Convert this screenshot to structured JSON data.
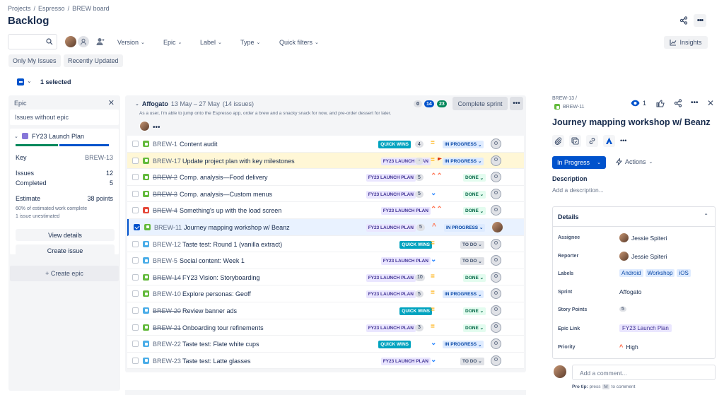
{
  "breadcrumbs": {
    "projects": "Projects",
    "project": "Espresso",
    "board": "BREW board"
  },
  "page_title": "Backlog",
  "toolbar": {
    "filters": [
      "Version",
      "Epic",
      "Label",
      "Type",
      "Quick filters"
    ],
    "insights": "Insights",
    "only_my_issues": "Only My Issues",
    "recently_updated": "Recently Updated"
  },
  "selection": {
    "text": "1 selected"
  },
  "epic_panel": {
    "header": "Epic",
    "issues_without_epic": "Issues without epic",
    "epic_name": "FY23 Launch Plan",
    "key_label": "Key",
    "key_value": "BREW-13",
    "issues_label": "Issues",
    "issues_value": "12",
    "completed_label": "Completed",
    "completed_value": "5",
    "estimate_label": "Estimate",
    "estimate_value": "38 points",
    "estimate_note": "60% of estimated work complete",
    "unestimated_note": "1 issue unestimated",
    "view_details": "View details",
    "create_issue": "Create issue",
    "create_epic": "+ Create epic"
  },
  "sprint": {
    "name": "Affogato",
    "dates": "13 May – 27 May",
    "count": "(14 issues)",
    "description": "As a user, I'm able to jump onto the Espresso app, order a brew and a snacky snack for now, and pre-order dessert for later.",
    "todo_count": "0",
    "inprogress_count": "14",
    "done_count": "23",
    "complete_label": "Complete sprint",
    "issues": [
      {
        "key": "BREW-1",
        "summary": "Content audit",
        "type": "story",
        "done": false,
        "label": "QUICK WINS",
        "label_type": "qw",
        "points": "4",
        "priority": "medium",
        "status": "IN PROGRESS",
        "status_type": "ip",
        "checked": false,
        "flag": false,
        "row": "",
        "photo": false
      },
      {
        "key": "BREW-17",
        "summary": "Update project plan with key milestones",
        "type": "story",
        "done": false,
        "label": "FY23 LAUNCH PLAN",
        "label_type": "fy",
        "points": "-",
        "priority": "medium",
        "status": "IN PROGRESS",
        "status_type": "ip",
        "checked": false,
        "flag": true,
        "row": "flag",
        "photo": false
      },
      {
        "key": "BREW-2",
        "summary": "Comp. analysis—Food delivery",
        "type": "story",
        "done": true,
        "label": "FY23 LAUNCH PLAN",
        "label_type": "fy",
        "points": "5",
        "priority": "high",
        "status": "DONE",
        "status_type": "done",
        "checked": false,
        "flag": false,
        "row": "",
        "photo": false
      },
      {
        "key": "BREW-3",
        "summary": "Comp. analysis—Custom menus",
        "type": "story",
        "done": true,
        "label": "FY23 LAUNCH PLAN",
        "label_type": "fy",
        "points": "5",
        "priority": "low",
        "status": "DONE",
        "status_type": "done",
        "checked": false,
        "flag": false,
        "row": "",
        "photo": false
      },
      {
        "key": "BREW-4",
        "summary": "Something's up with the load screen",
        "type": "bug",
        "done": true,
        "label": "FY23 LAUNCH PLAN",
        "label_type": "fy",
        "points": "",
        "priority": "high",
        "status": "DONE",
        "status_type": "done",
        "checked": false,
        "flag": false,
        "row": "",
        "photo": false
      },
      {
        "key": "BREW-11",
        "summary": "Journey mapping workshop w/ Beanz",
        "type": "story",
        "done": false,
        "label": "FY23 LAUNCH PLAN",
        "label_type": "fy",
        "points": "5",
        "priority": "medium-high",
        "status": "IN PROGRESS",
        "status_type": "ip",
        "checked": true,
        "flag": false,
        "row": "sel",
        "photo": true
      },
      {
        "key": "BREW-12",
        "summary": "Taste test: Round 1 (vanilla extract)",
        "type": "task",
        "done": false,
        "label": "QUICK WINS",
        "label_type": "qw",
        "points": "",
        "priority": "medium",
        "status": "TO DO",
        "status_type": "todo",
        "checked": false,
        "flag": false,
        "row": "",
        "photo": false
      },
      {
        "key": "BREW-5",
        "summary": "Social content: Week 1",
        "type": "task",
        "done": false,
        "label": "FY23 LAUNCH PLAN",
        "label_type": "fy",
        "points": "",
        "priority": "low",
        "status": "TO DO",
        "status_type": "todo",
        "checked": false,
        "flag": false,
        "row": "",
        "photo": false
      },
      {
        "key": "BREW-14",
        "summary": "FY23 Vision: Storyboarding",
        "type": "story",
        "done": true,
        "label": "FY23 LAUNCH PLAN",
        "label_type": "fy",
        "points": "10",
        "priority": "medium",
        "status": "DONE",
        "status_type": "done",
        "checked": false,
        "flag": false,
        "row": "",
        "photo": false
      },
      {
        "key": "BREW-10",
        "summary": "Explore personas: Geoff",
        "type": "story",
        "done": false,
        "label": "FY23 LAUNCH PLAN",
        "label_type": "fy",
        "points": "5",
        "priority": "medium",
        "status": "IN PROGRESS",
        "status_type": "ip",
        "checked": false,
        "flag": false,
        "row": "",
        "photo": false
      },
      {
        "key": "BREW-20",
        "summary": "Review banner ads",
        "type": "task",
        "done": true,
        "label": "QUICK WINS",
        "label_type": "qw",
        "points": "",
        "priority": "medium",
        "status": "DONE",
        "status_type": "done",
        "checked": false,
        "flag": false,
        "row": "",
        "photo": false
      },
      {
        "key": "BREW-21",
        "summary": "Onboarding tour refinements",
        "type": "story",
        "done": true,
        "label": "FY23 LAUNCH PLAN",
        "label_type": "fy",
        "points": "3",
        "priority": "medium",
        "status": "DONE",
        "status_type": "done",
        "checked": false,
        "flag": false,
        "row": "",
        "photo": false
      },
      {
        "key": "BREW-22",
        "summary": "Taste test: Flate white cups",
        "type": "task",
        "done": false,
        "label": "QUICK WINS",
        "label_type": "qw",
        "points": "",
        "priority": "low",
        "status": "IN PROGRESS",
        "status_type": "ip",
        "checked": false,
        "flag": false,
        "row": "",
        "photo": false
      },
      {
        "key": "BREW-23",
        "summary": "Taste test: Latte glasses",
        "type": "task",
        "done": false,
        "label": "FY23 LAUNCH PLAN",
        "label_type": "fy",
        "points": "",
        "priority": "low",
        "status": "TO DO",
        "status_type": "todo",
        "checked": false,
        "flag": false,
        "row": "",
        "photo": false
      }
    ]
  },
  "detail": {
    "key": "BREW-13",
    "key_sep": "/",
    "parent_key": "BREW-11",
    "watch_count": "1",
    "title": "Journey mapping workshop w/ Beanz",
    "status": "In Progress",
    "actions": "Actions",
    "description_label": "Description",
    "description_placeholder": "Add a description...",
    "details_label": "Details",
    "assignee_label": "Assignee",
    "assignee": "Jessie Spiteri",
    "reporter_label": "Reporter",
    "reporter": "Jessie Spiteri",
    "labels_label": "Labels",
    "labels": [
      "Android",
      "Workshop",
      "iOS"
    ],
    "sprint_label": "Sprint",
    "sprint": "Affogato",
    "story_points_label": "Story Points",
    "story_points": "5",
    "epic_link_label": "Epic Link",
    "epic_link": "FY23 Launch Plan",
    "priority_label": "Priority",
    "priority": "High",
    "comment_placeholder": "Add a comment...",
    "protip_bold": "Pro tip:",
    "protip_press": "press",
    "protip_key": "M",
    "protip_rest": "to comment"
  },
  "colors": {
    "primary": "#0052cc",
    "quick_wins": "#00a3bf",
    "epic": "#8777d9",
    "done": "#00875a",
    "flag_row": "#fff7d6"
  }
}
